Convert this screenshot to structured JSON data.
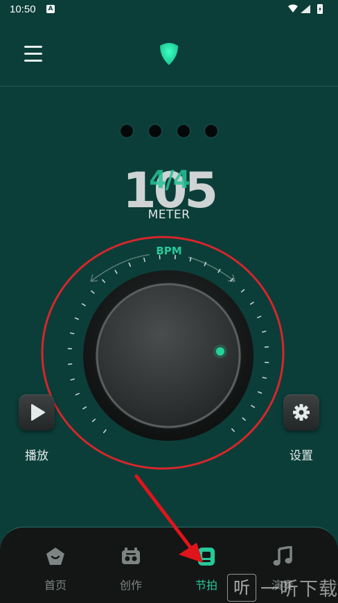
{
  "status_bar": {
    "time": "10:50",
    "notification_icon": "A"
  },
  "header": {
    "menu_icon": "hamburger-icon",
    "logo_icon": "guitar-pick-icon"
  },
  "metronome": {
    "beat_dots": [
      1,
      2,
      3,
      4
    ],
    "bpm": "105",
    "meter": "4/4",
    "meter_label": "METER",
    "dial_label": "BPM",
    "accent_color": "#27c296"
  },
  "controls": {
    "play_label": "播放",
    "settings_label": "设置"
  },
  "tabs": [
    {
      "label": "首页",
      "icon": "home-pentagon-icon",
      "active": false
    },
    {
      "label": "创作",
      "icon": "creation-icon",
      "active": false
    },
    {
      "label": "节拍",
      "icon": "metronome-icon",
      "active": true
    },
    {
      "label": "演奏",
      "icon": "music-note-icon",
      "active": false
    }
  ],
  "watermark": {
    "glyph": "听",
    "text": "一听下载"
  }
}
